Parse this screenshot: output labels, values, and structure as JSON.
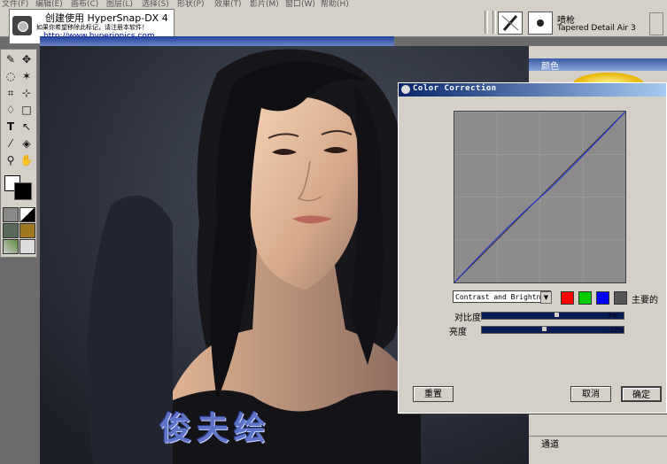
{
  "menu": {
    "items": [
      "文件(F)",
      "编辑(E)",
      "画布(C)",
      "图层(L)",
      "选择(S)",
      "形状(P)",
      "效果(T)",
      "影片(M)",
      "窗口(W)",
      "帮助(H)"
    ]
  },
  "hypersnap": {
    "title": "创建使用 HyperSnap-DX 4",
    "notice": "如果你希望移除此标记，请注册本软件！",
    "url": "http://www.hyperionics.com"
  },
  "brush": {
    "name": "喷枪",
    "variant": "Tapered Detail Air 3"
  },
  "colors_panel": {
    "title": "颜色"
  },
  "channels_panel": {
    "title": "通道"
  },
  "artwork": {
    "signature": "俊夫绘"
  },
  "color_correction": {
    "title": "Color Correction",
    "mode": "Contrast and Brightne",
    "master_label": "主要的",
    "contrast": {
      "label": "对比度",
      "value": "7%",
      "level": 0.53
    },
    "brightness": {
      "label": "亮度",
      "value": "-12%",
      "level": 0.44
    },
    "reset_label": "重置",
    "cancel_label": "取消",
    "ok_label": "确定",
    "channel_colors": {
      "red": "#ff0000",
      "green": "#00cc00",
      "blue": "#0000ff",
      "master": "#555555"
    }
  }
}
